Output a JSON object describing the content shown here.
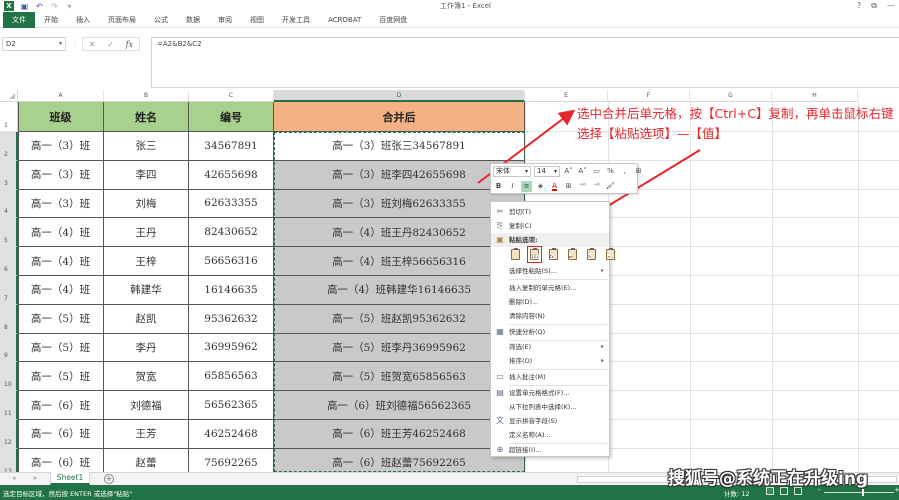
{
  "window": {
    "title": "工作簿1 - Excel",
    "controls": [
      "?",
      "⧉",
      "—"
    ]
  },
  "ribbon": {
    "tabs": [
      "文件",
      "开始",
      "插入",
      "页面布局",
      "公式",
      "数据",
      "审阅",
      "视图",
      "开发工具",
      "ACROBAT",
      "百度网盘"
    ]
  },
  "formula_bar": {
    "name_box": "D2",
    "cancel_icon": "✕",
    "enter_icon": "✓",
    "fx_label": "fx",
    "formula": "=A2&B2&C2"
  },
  "columns": [
    "A",
    "B",
    "C",
    "D",
    "E",
    "F",
    "G",
    "H"
  ],
  "rows": [
    "1",
    "2",
    "3",
    "4",
    "5",
    "6",
    "7",
    "8",
    "9",
    "10",
    "11",
    "12",
    "13"
  ],
  "table": {
    "headers": [
      "班级",
      "姓名",
      "编号",
      "合并后"
    ],
    "rows": [
      [
        "高一（3）班",
        "张三",
        "34567891",
        "高一（3）班张三34567891"
      ],
      [
        "高一（3）班",
        "李四",
        "42655698",
        "高一（3）班李四42655698"
      ],
      [
        "高一（3）班",
        "刘梅",
        "62633355",
        "高一（3）班刘梅62633355"
      ],
      [
        "高一（4）班",
        "王丹",
        "82430652",
        "高一（4）班王丹82430652"
      ],
      [
        "高一（4）班",
        "王梓",
        "56656316",
        "高一（4）班王梓56656316"
      ],
      [
        "高一（4）班",
        "韩建华",
        "16146635",
        "高一（4）班韩建华16146635"
      ],
      [
        "高一（5）班",
        "赵凯",
        "95362632",
        "高一（5）班赵凯95362632"
      ],
      [
        "高一（5）班",
        "李丹",
        "36995962",
        "高一（5）班李丹36995962"
      ],
      [
        "高一（5）班",
        "贺宽",
        "65856563",
        "高一（5）班贺宽65856563"
      ],
      [
        "高一（6）班",
        "刘德福",
        "56562365",
        "高一（6）班刘德福56562365"
      ],
      [
        "高一（6）班",
        "王芳",
        "46252468",
        "高一（6）班王芳46252468"
      ],
      [
        "高一（6）班",
        "赵蕾",
        "75692265",
        "高一（6）班赵蕾75692265"
      ]
    ]
  },
  "colors": {
    "excel_green": "#217346",
    "header_green": "#a9d18e",
    "header_orange": "#f4b183",
    "selection_grey": "#c9c9c9",
    "annotation_red": "#e8262b"
  },
  "annotation": {
    "text": "选中合并后单元格，按【Ctrl+C】复制，再单击鼠标右键选择【粘贴选项】—【值】"
  },
  "mini_toolbar": {
    "font": "宋体",
    "size": "14",
    "grow_font": "A˄",
    "shrink_font": "A˅",
    "percent": "%",
    "comma": ",",
    "bold": "B",
    "italic": "I",
    "font_color": "A"
  },
  "context_menu": {
    "items": [
      {
        "label": "剪切(T)",
        "icon": "✂"
      },
      {
        "label": "复制(C)",
        "icon": "⎘"
      },
      {
        "label": "粘贴选项:",
        "icon": "📋"
      },
      {
        "label": "选择性粘贴(S)...",
        "icon": "",
        "submenu": "▸"
      },
      {
        "label": "插入复制的单元格(E)...",
        "icon": ""
      },
      {
        "label": "删除(D)...",
        "icon": ""
      },
      {
        "label": "清除内容(N)",
        "icon": ""
      },
      {
        "label": "快速分析(Q)",
        "icon": "▦"
      },
      {
        "label": "筛选(E)",
        "icon": "",
        "submenu": "▸"
      },
      {
        "label": "排序(O)",
        "icon": "",
        "submenu": "▸"
      },
      {
        "label": "插入批注(M)",
        "icon": "▭"
      },
      {
        "label": "设置单元格格式(F)...",
        "icon": "▤"
      },
      {
        "label": "从下拉列表中选择(K)...",
        "icon": ""
      },
      {
        "label": "显示拼音字段(S)",
        "icon": "文"
      },
      {
        "label": "定义名称(A)...",
        "icon": ""
      },
      {
        "label": "超链接(I)...",
        "icon": "🌐"
      }
    ],
    "paste_options": [
      "粘贴",
      "值",
      "公式",
      "转置",
      "格式",
      "粘贴链接"
    ],
    "paste_value_label": "123"
  },
  "sheets": {
    "nav": "◂ ▸",
    "active": "Sheet1",
    "add": "+"
  },
  "status_bar": {
    "message": "选定目标区域，然后按 ENTER 或选择\"粘贴\"",
    "count": "计数: 12"
  },
  "watermark": "搜狐号@系统正在升级ing"
}
